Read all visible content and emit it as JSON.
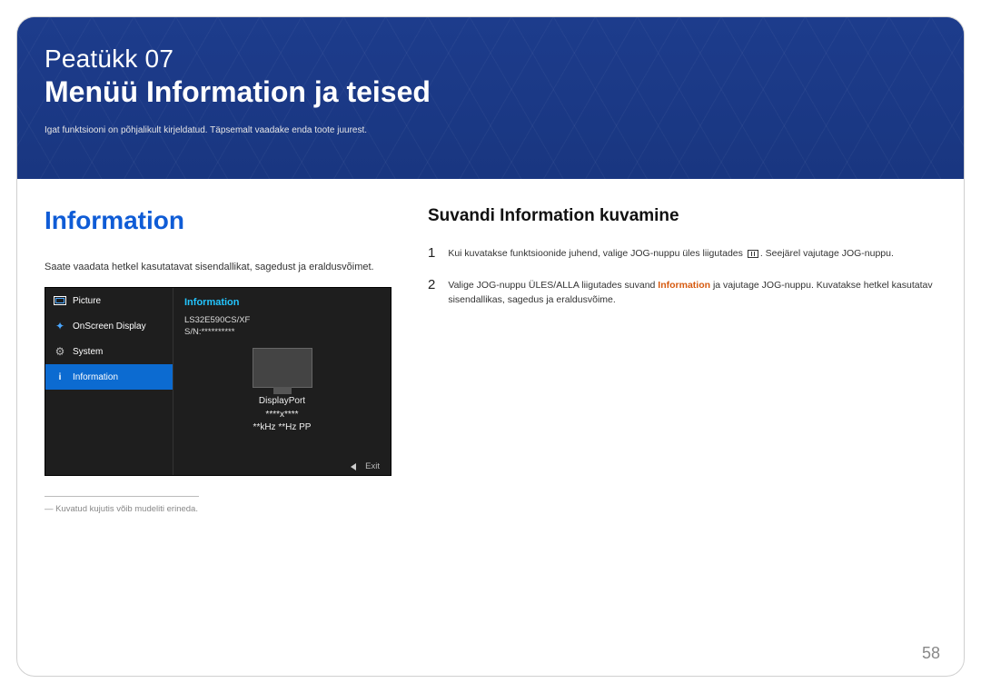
{
  "header": {
    "chapter_label": "Peatükk 07",
    "chapter_title": "Menüü Information ja teised",
    "chapter_subtitle": "Igat funktsiooni on põhjalikult kirjeldatud. Täpsemalt vaadake enda toote juurest."
  },
  "left": {
    "section_heading": "Information",
    "intro_text": "Saate vaadata hetkel kasutatavat sisendallikat, sagedust ja eraldusvõimet.",
    "footnote": "― Kuvatud kujutis võib mudeliti erineda."
  },
  "osd": {
    "menu": {
      "picture": "Picture",
      "onscreen": "OnScreen Display",
      "system": "System",
      "information": "Information"
    },
    "panel_title": "Information",
    "model_line1": "LS32E590CS/XF",
    "model_line2": "S/N:**********",
    "port": "DisplayPort",
    "resolution": "****x****",
    "freq": "**kHz **Hz PP",
    "exit": "Exit"
  },
  "right": {
    "sub_heading": "Suvandi Information kuvamine",
    "steps": {
      "1": {
        "num": "1",
        "pre": "Kui kuvatakse funktsioonide juhend, valige JOG-nuppu üles liigutades ",
        "post": ". Seejärel vajutage JOG-nuppu."
      },
      "2": {
        "num": "2",
        "pre": "Valige JOG-nuppu ÜLES/ALLA liigutades suvand ",
        "accent": "Information",
        "post": " ja vajutage JOG-nuppu. Kuvatakse hetkel kasutatav sisendallikas, sagedus ja eraldusvõime."
      }
    }
  },
  "page_number": "58"
}
